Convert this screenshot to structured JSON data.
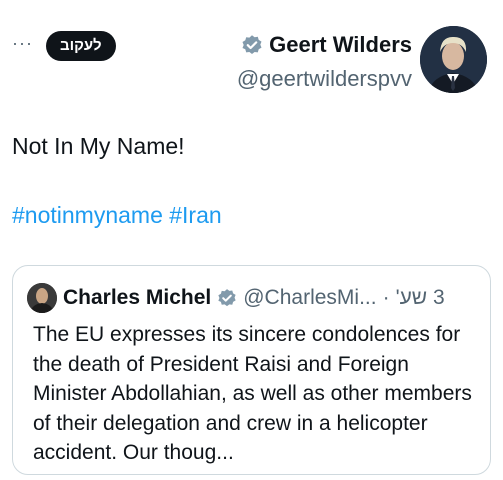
{
  "header": {
    "more_label": "···",
    "follow_label": "לעקוב",
    "display_name": "Geert Wilders",
    "handle": "@geertwilderspvv"
  },
  "tweet": {
    "text": "Not In My Name!",
    "hashtags": [
      "#notinmyname",
      "#Iran"
    ]
  },
  "quote": {
    "name": "Charles Michel",
    "handle": "@CharlesMi...",
    "separator": "·",
    "time": "3 שע'",
    "text": "The EU expresses its sincere condolences for the death of President Raisi and Foreign Minister Abdollahian, as well as other members of their delegation and crew in a helicopter accident. Our thoug..."
  },
  "colors": {
    "accent": "#1d9bf0",
    "verified_badge": "#829aab",
    "text": "#0f1419",
    "secondary": "#536471",
    "border": "#cfd9de",
    "follow_button": "#0f1419"
  },
  "icons": {
    "verified": "verified-badge-icon",
    "more": "more-options-icon"
  }
}
